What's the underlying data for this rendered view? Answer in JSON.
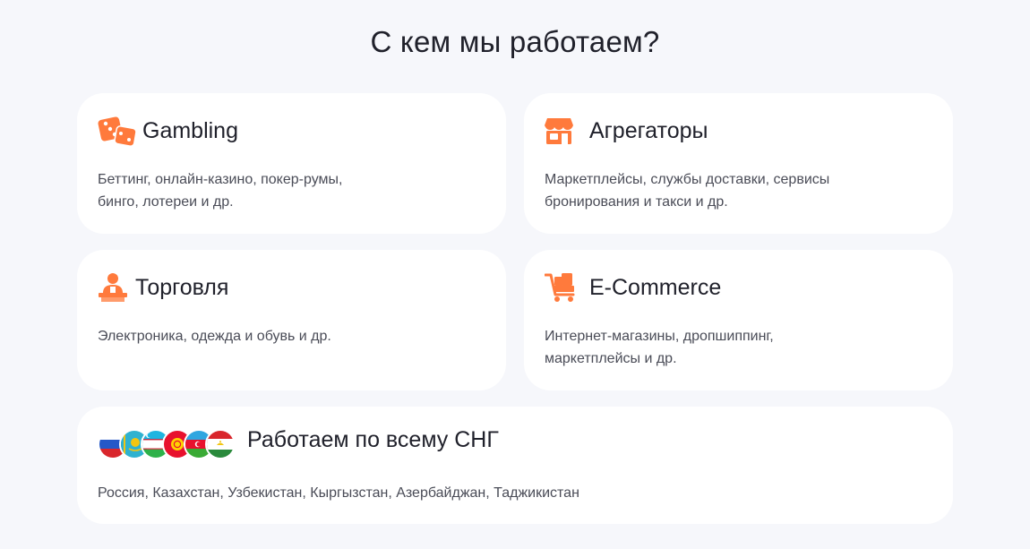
{
  "page": {
    "title": "С кем мы работаем?"
  },
  "accent_color": "#ff7a3c",
  "cards": [
    {
      "icon": "dice-icon",
      "title": "Gambling",
      "description": "Беттинг, онлайн-казино, покер-румы, бинго, лотереи и др."
    },
    {
      "icon": "storefront-icon",
      "title": "Агрегаторы",
      "description": "Маркетплейсы, службы доставки, сервисы бронирования и такси и др."
    },
    {
      "icon": "seller-icon",
      "title": "Торговля",
      "description": "Электроника, одежда и обувь и др."
    },
    {
      "icon": "shopping-cart-icon",
      "title": "E-Commerce",
      "description": "Интернет-магазины, дропшиппинг, маркетплейсы и др."
    }
  ],
  "cis": {
    "title": "Работаем по всему СНГ",
    "description": "Россия, Казахстан, Узбекистан, Кыргызстан, Азербайджан, Таджикистан",
    "flags": [
      "russia-flag-icon",
      "kazakhstan-flag-icon",
      "uzbekistan-flag-icon",
      "kyrgyzstan-flag-icon",
      "azerbaijan-flag-icon",
      "tajikistan-flag-icon"
    ]
  }
}
